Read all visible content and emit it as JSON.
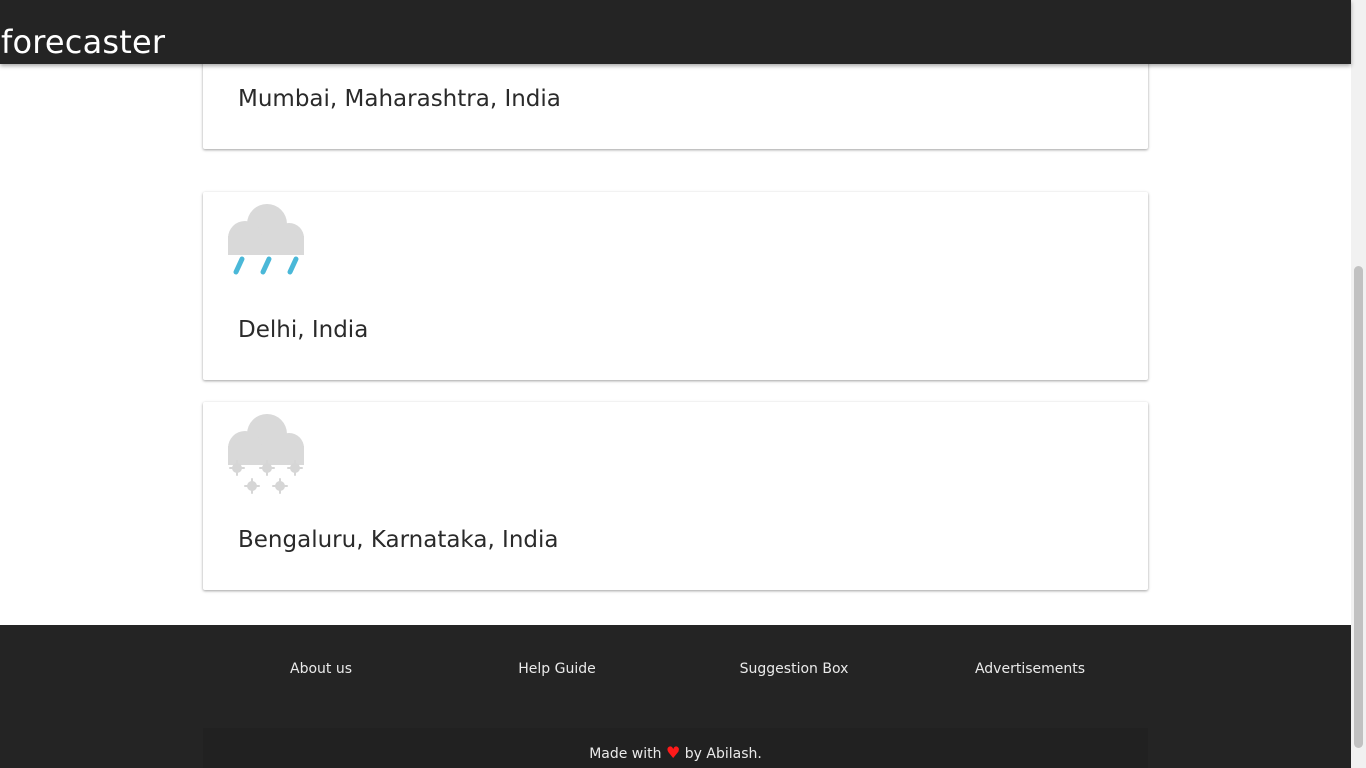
{
  "app": {
    "title": "forecaster"
  },
  "cards": [
    {
      "city": "Mumbai, Maharashtra, India",
      "icon": ""
    },
    {
      "city": "Delhi, India",
      "icon": "rain-icon"
    },
    {
      "city": "Bengaluru, Karnataka, India",
      "icon": "snow-icon"
    }
  ],
  "footer": {
    "links": [
      "About us",
      "Help Guide",
      "Suggestion Box",
      "Advertisements"
    ],
    "made_with_prefix": "Made with",
    "heart": "♥",
    "made_with_suffix": "by Abilash."
  },
  "colors": {
    "header_bg": "#242424",
    "footer_bg": "#242424",
    "rain_drop": "#4ab8d8",
    "cloud": "#d9d9d9",
    "heart": "#ff1a1a"
  }
}
